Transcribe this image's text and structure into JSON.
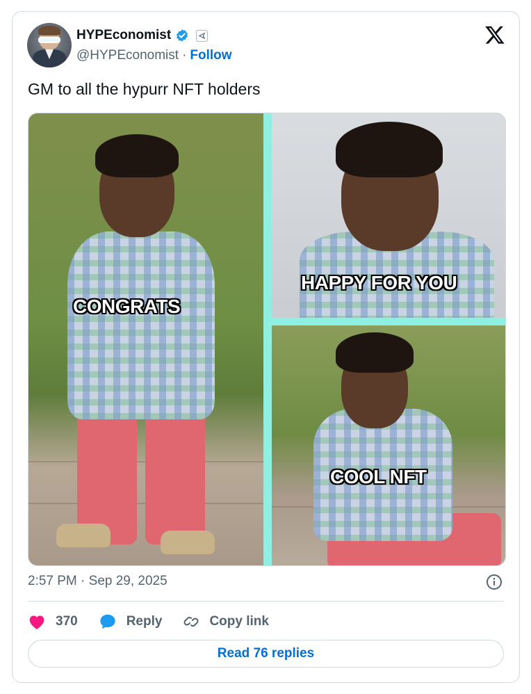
{
  "author": {
    "display_name": "HYPEconomist",
    "handle": "@HYPEconomist",
    "separator": "·",
    "follow_label": "Follow",
    "verified": true
  },
  "tweet": {
    "text": "GM to all the hypurr NFT holders",
    "timestamp": "2:57 PM · Sep 29, 2025"
  },
  "media": {
    "captions": {
      "left": "CONGRATS",
      "top_right": "HAPPY FOR YOU",
      "bottom_right": "COOL NFT"
    },
    "divider_color": "#8df0e2"
  },
  "actions": {
    "like_count": "370",
    "reply_label": "Reply",
    "copy_link_label": "Copy link",
    "read_replies_label": "Read 76 replies"
  },
  "colors": {
    "link_blue": "#006fd6",
    "like_pink": "#f91880",
    "verified_blue": "#1d9bf0",
    "muted_text": "#536471",
    "border": "#cfd9de"
  },
  "icons": {
    "verified": "verified-badge-icon",
    "affiliate": "affiliate-badge-icon",
    "platform": "x-logo-icon",
    "info": "info-icon",
    "like": "heart-icon",
    "reply": "speech-bubble-icon",
    "copy_link": "link-icon"
  }
}
